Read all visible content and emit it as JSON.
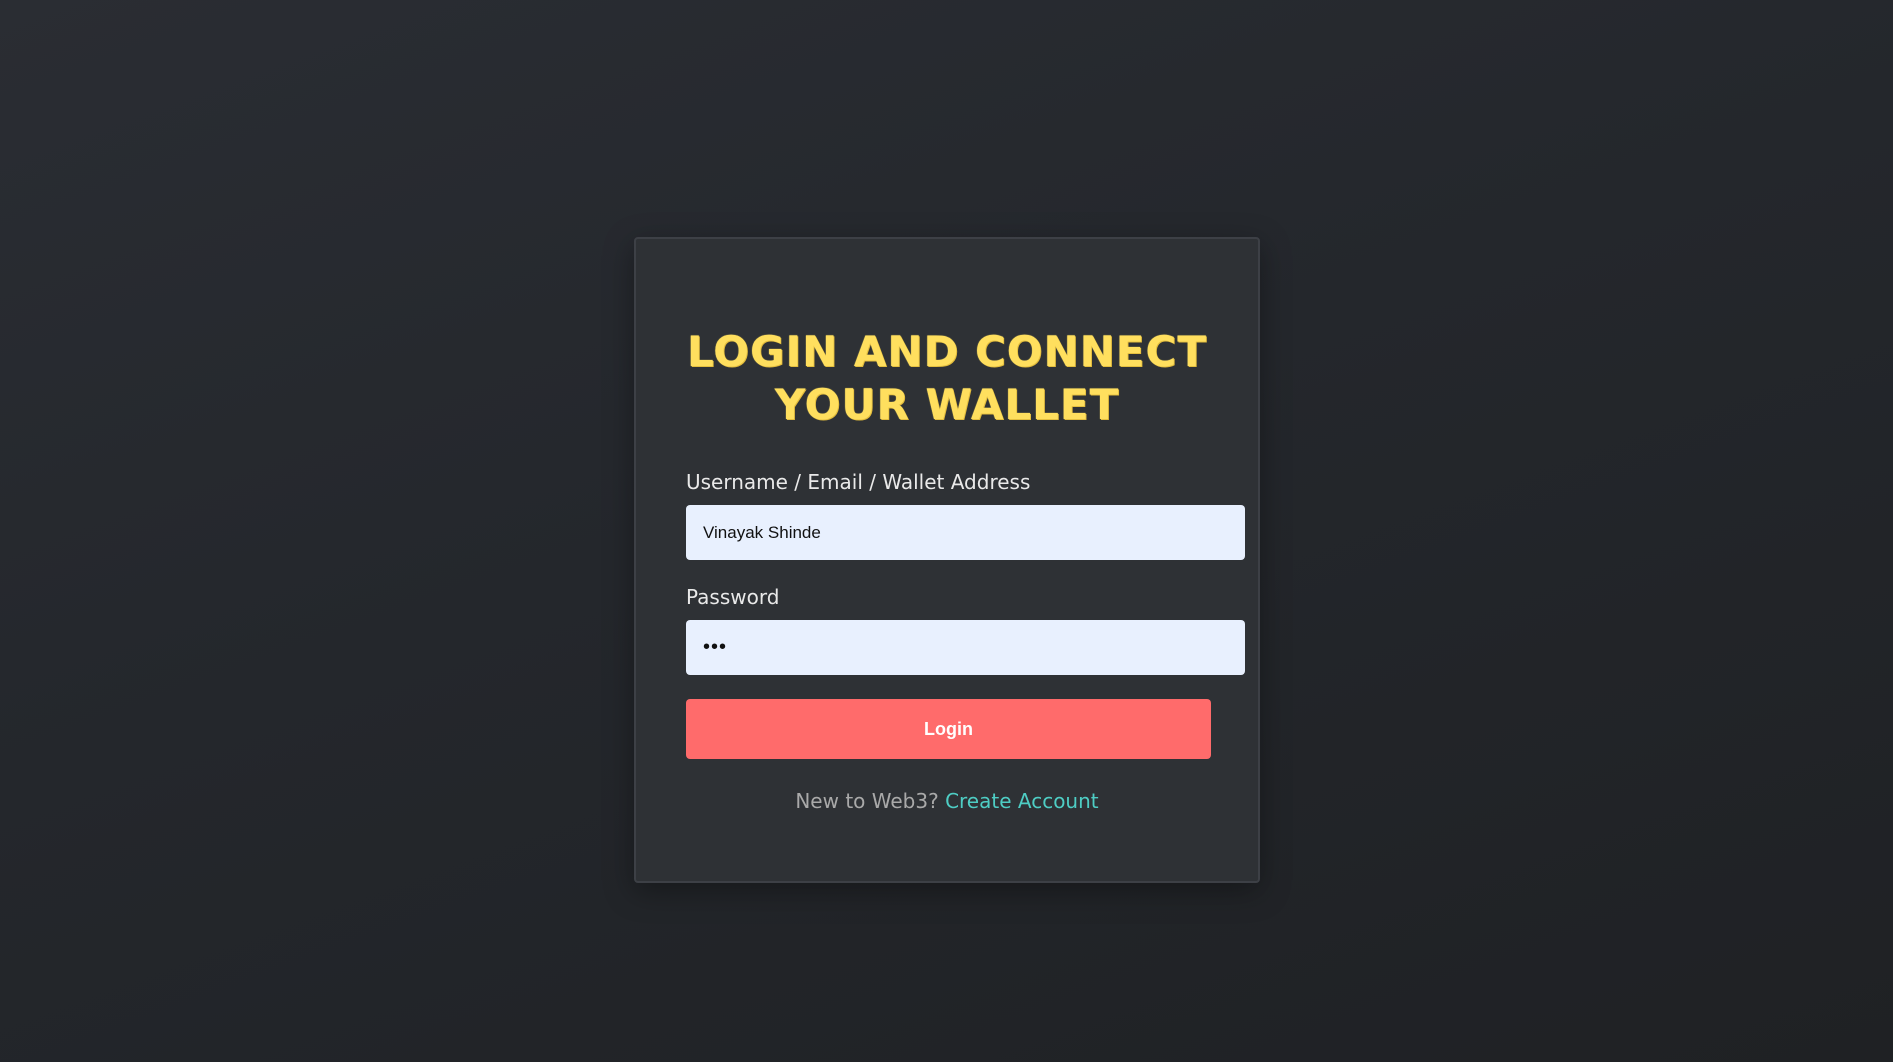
{
  "login_card": {
    "title_line1": "Login and Connect",
    "title_line2": "Your Wallet",
    "username_label": "Username / Email / Wallet Address",
    "username_value": "Vinayak Shinde",
    "password_label": "Password",
    "password_value": "abc",
    "login_button_label": "Login",
    "footer_prompt": "New to Web3?",
    "create_account_link": "Create Account"
  },
  "colors": {
    "background": "#24272c",
    "card": "#2e3135",
    "title": "#ffdf5e",
    "input_background": "#e8f0fe",
    "login_button": "#ff6b6b",
    "link": "#4ecdc4"
  }
}
